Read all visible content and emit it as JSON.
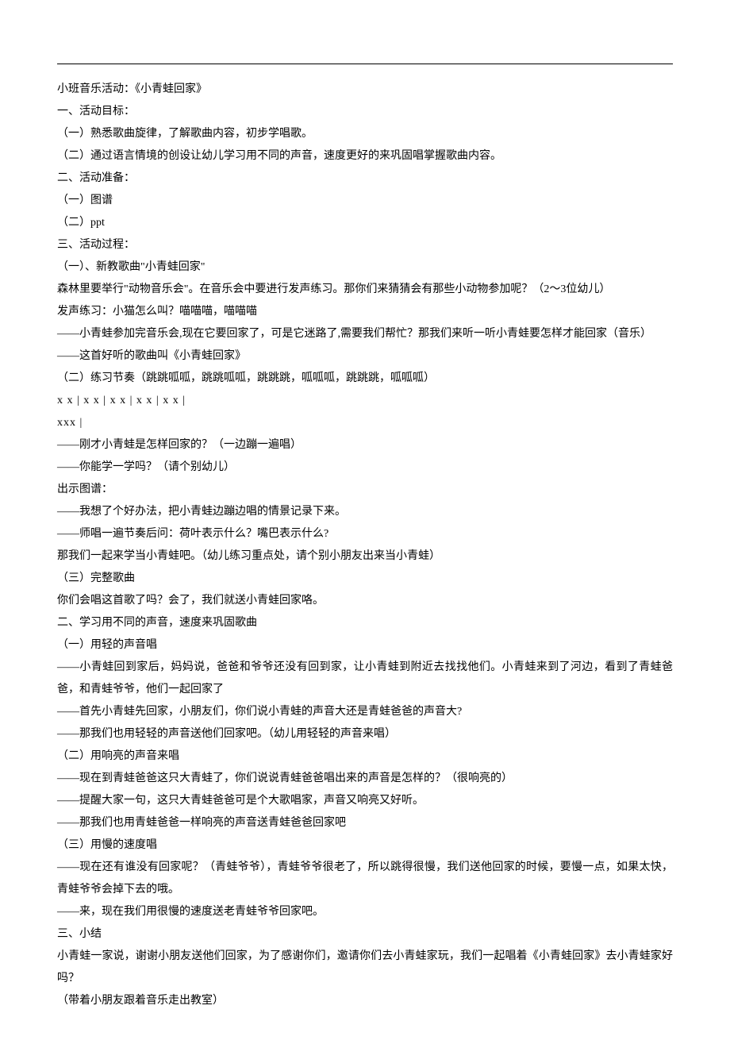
{
  "lines": [
    "小班音乐活动：《小青蛙回家》",
    "一、活动目标：",
    "（一）熟悉歌曲旋律，了解歌曲内容，初步学唱歌。",
    "（二）通过语言情境的创设让幼儿学习用不同的声音，速度更好的来巩固唱掌握歌曲内容。",
    "二、活动准备：",
    "（一）图谱",
    "（二）ppt",
    "三、活动过程：",
    "（一）、新教歌曲\"小青蛙回家\"",
    "森林里要举行\"动物音乐会\"。在音乐会中要进行发声练习。那你们来猜猜会有那些小动物参加呢？（2～3位幼儿）",
    "发声练习：小猫怎么叫？喵喵喵，喵喵喵",
    "——小青蛙参加完音乐会,现在它要回家了，可是它迷路了,需要我们帮忙？那我们来听一听小青蛙要怎样才能回家（音乐）",
    "——这首好听的歌曲叫《小青蛙回家》",
    "（二）练习节奏（跳跳呱呱，跳跳呱呱，跳跳跳，呱呱呱，跳跳跳，呱呱呱）",
    "x x | x x | x x | x x | x x |",
    "xxx |",
    "——刚才小青蛙是怎样回家的？（一边蹦一遍唱）",
    "——你能学一学吗？（请个别幼儿）",
    "出示图谱：",
    "——我想了个好办法，把小青蛙边蹦边唱的情景记录下来。",
    "——师唱一遍节奏后问：荷叶表示什么？嘴巴表示什么?",
    "那我们一起来学当小青蛙吧。（幼儿练习重点处，请个别小朋友出来当小青蛙）",
    "（三）完整歌曲",
    "你们会唱这首歌了吗？会了，我们就送小青蛙回家咯。",
    "二、学习用不同的声音，速度来巩固歌曲",
    "（一）用轻的声音唱",
    "——小青蛙回到家后，妈妈说，爸爸和爷爷还没有回到家，让小青蛙到附近去找找他们。小青蛙来到了河边，看到了青蛙爸爸，和青蛙爷爷，他们一起回家了",
    "——首先小青蛙先回家，小朋友们，你们说小青蛙的声音大还是青蛙爸爸的声音大?",
    "——那我们也用轻轻的声音送他们回家吧。（幼儿用轻轻的声音来唱）",
    "（二）用响亮的声音来唱",
    "——现在到青蛙爸爸这只大青蛙了，你们说说青蛙爸爸唱出来的声音是怎样的？（很响亮的）",
    "——提醒大家一句，这只大青蛙爸爸可是个大歌唱家，声音又响亮又好听。",
    "——那我们也用青蛙爸爸一样响亮的声音送青蛙爸爸回家吧",
    "（三）用慢的速度唱",
    "——现在还有谁没有回家呢？（青蛙爷爷），青蛙爷爷很老了，所以跳得很慢，我们送他回家的时候，要慢一点，如果太快，青蛙爷爷会掉下去的哦。",
    "——来，现在我们用很慢的速度送老青蛙爷爷回家吧。",
    "三、小结",
    "小青蛙一家说，谢谢小朋友送他们回家，为了感谢你们，邀请你们去小青蛙家玩，我们一起唱着《小青蛙回家》去小青蛙家好吗？",
    "（带着小朋友跟着音乐走出教室）"
  ],
  "rhythm_line_indices": [
    14,
    15
  ]
}
